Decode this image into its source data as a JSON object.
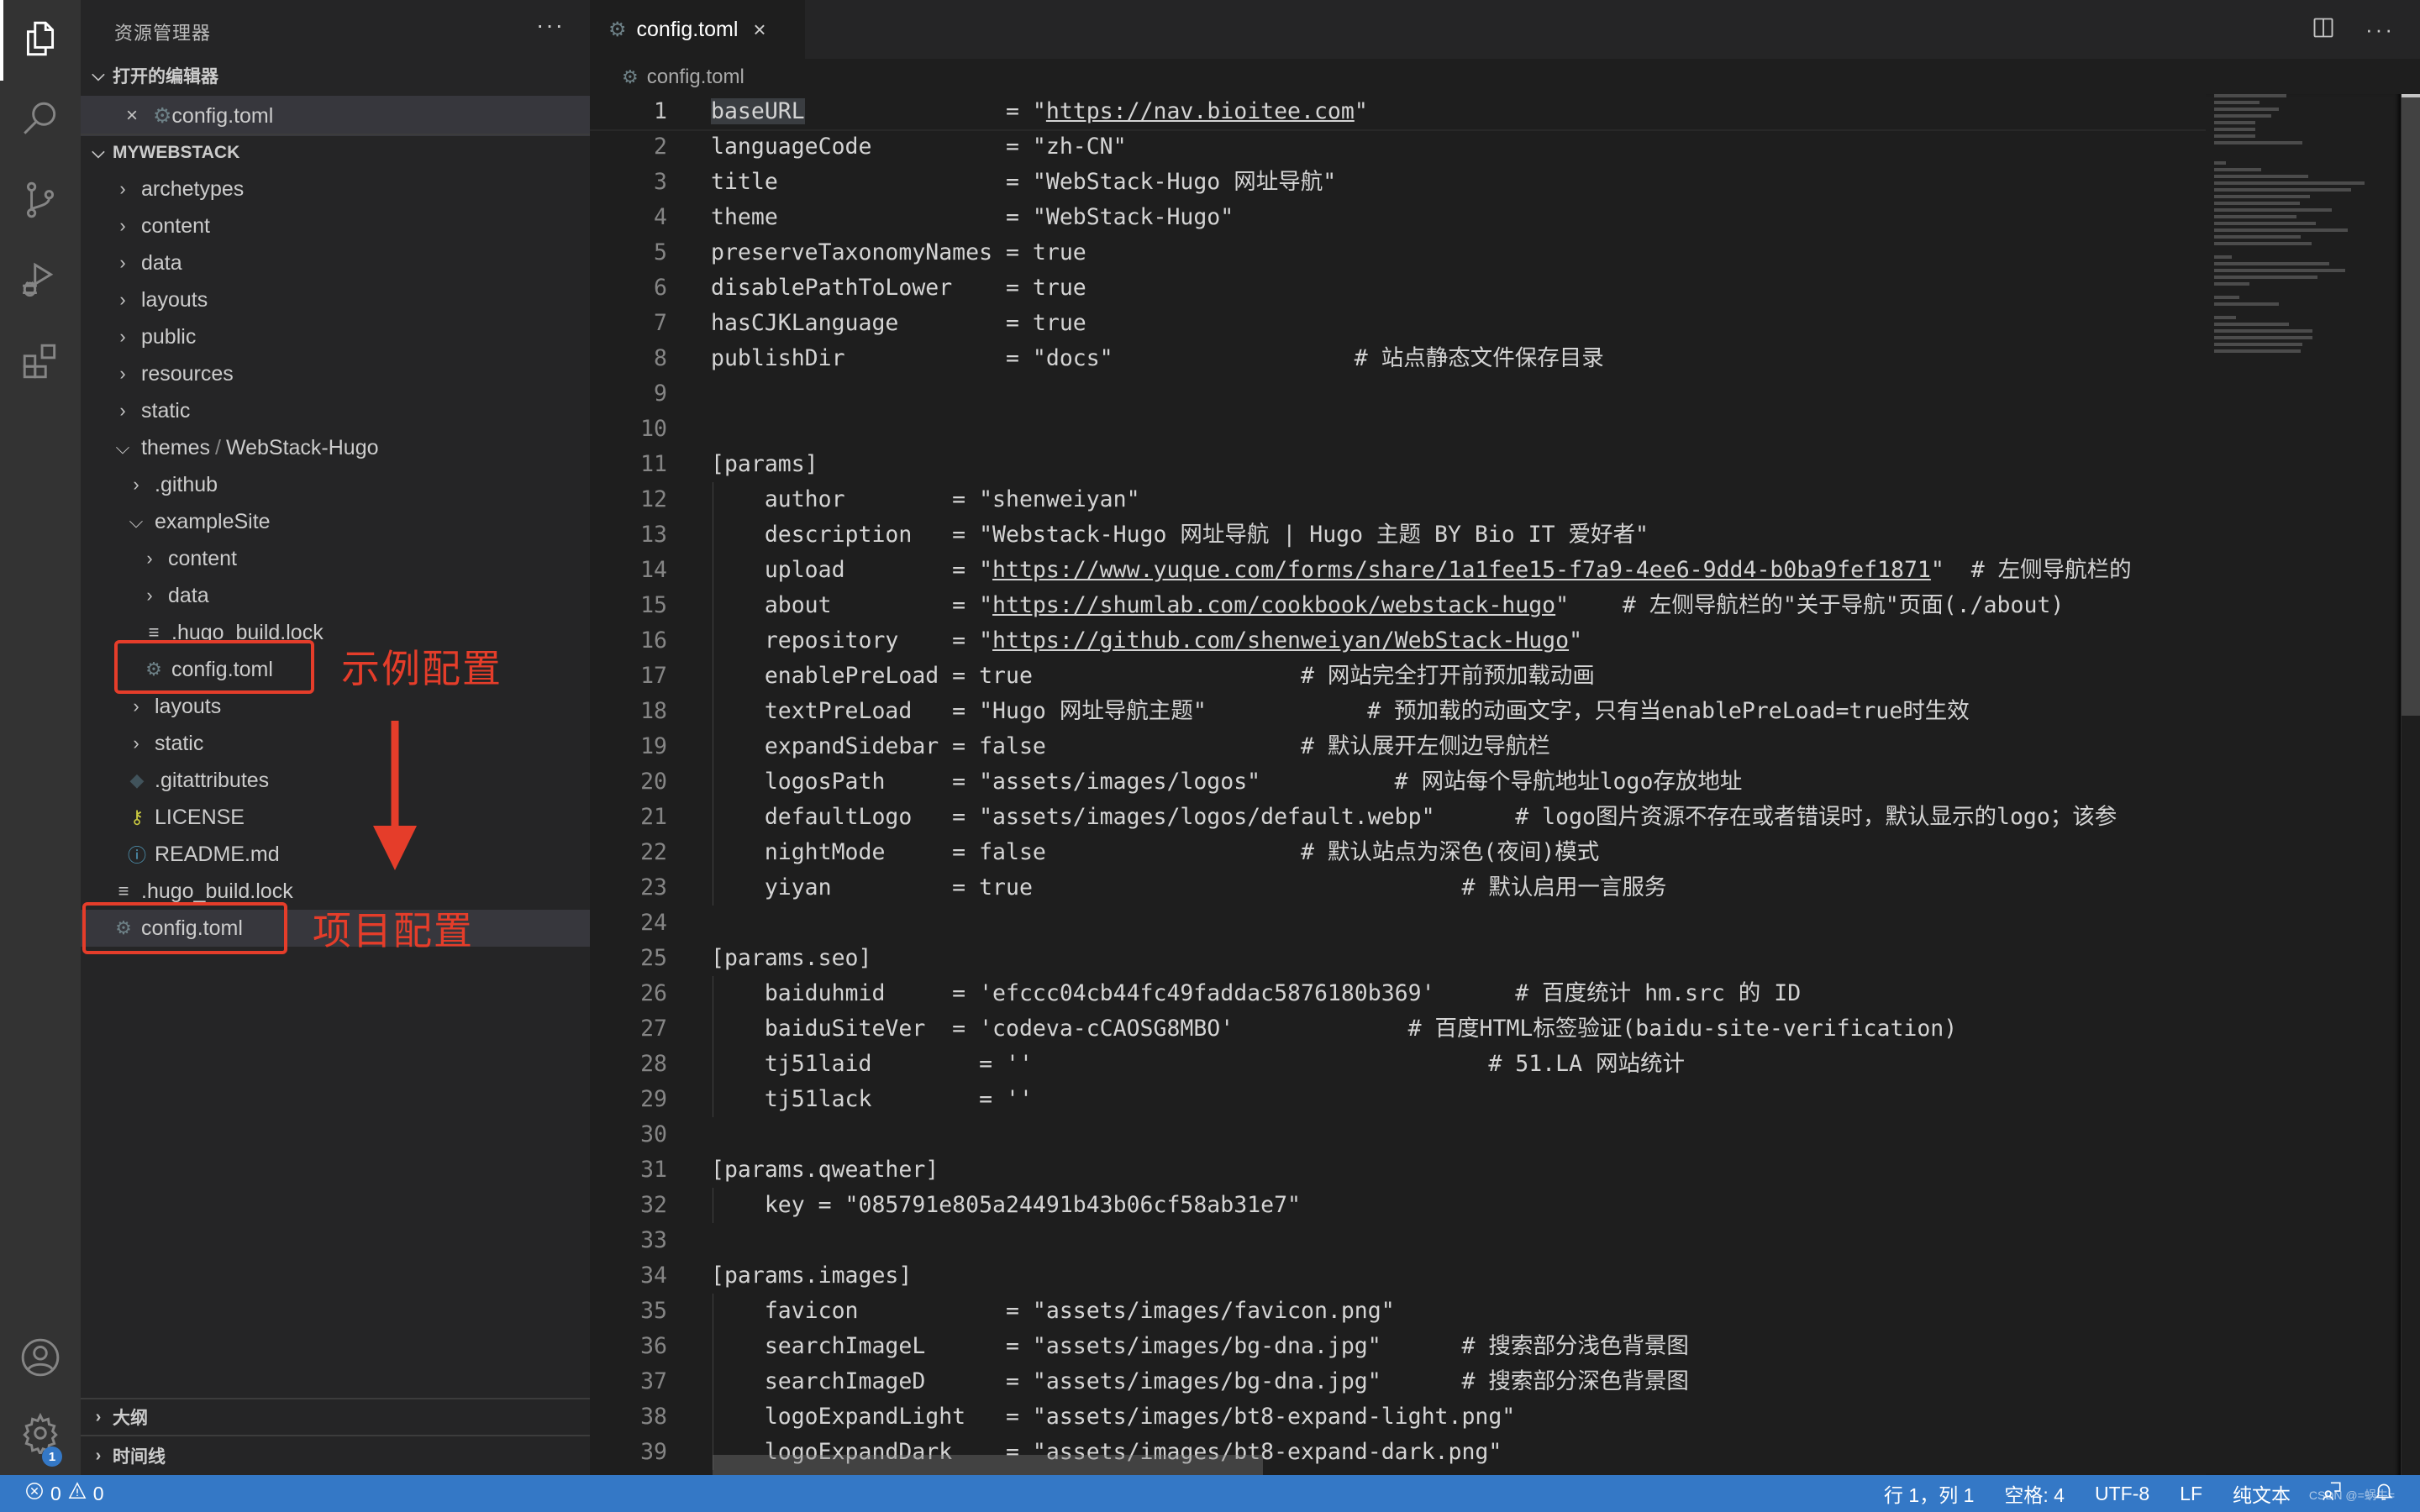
{
  "activity_bar": {
    "items": [
      {
        "name": "explorer",
        "icon": "files-icon",
        "active": true
      },
      {
        "name": "search",
        "icon": "search-icon"
      },
      {
        "name": "source-control",
        "icon": "source-control-icon"
      },
      {
        "name": "run-debug",
        "icon": "run-debug-icon"
      },
      {
        "name": "extensions",
        "icon": "extensions-icon"
      }
    ],
    "bottom": [
      {
        "name": "accounts",
        "icon": "account-icon"
      },
      {
        "name": "manage",
        "icon": "gear-icon",
        "badge": "1"
      }
    ]
  },
  "sidebar": {
    "title": "资源管理器",
    "more": "···",
    "open_editors": {
      "label": "打开的编辑器",
      "items": [
        {
          "label": "config.toml",
          "icon": "gear-icon"
        }
      ]
    },
    "workspace": {
      "label": "MYWEBSTACK",
      "tree": [
        {
          "label": "archetypes",
          "type": "folder",
          "expanded": false,
          "depth": 0
        },
        {
          "label": "content",
          "type": "folder",
          "expanded": false,
          "depth": 0
        },
        {
          "label": "data",
          "type": "folder",
          "expanded": false,
          "depth": 0
        },
        {
          "label": "layouts",
          "type": "folder",
          "expanded": false,
          "depth": 0
        },
        {
          "label": "public",
          "type": "folder",
          "expanded": false,
          "depth": 0
        },
        {
          "label": "resources",
          "type": "folder",
          "expanded": false,
          "depth": 0
        },
        {
          "label": "static",
          "type": "folder",
          "expanded": false,
          "depth": 0
        },
        {
          "label": "themes",
          "label2": "WebStack-Hugo",
          "separator": "/",
          "type": "folder",
          "expanded": true,
          "depth": 0
        },
        {
          "label": ".github",
          "type": "folder",
          "expanded": false,
          "depth": 1
        },
        {
          "label": "exampleSite",
          "type": "folder",
          "expanded": true,
          "depth": 1
        },
        {
          "label": "content",
          "type": "folder",
          "expanded": false,
          "depth": 2
        },
        {
          "label": "data",
          "type": "folder",
          "expanded": false,
          "depth": 2
        },
        {
          "label": ".hugo_build.lock",
          "type": "file",
          "icon": "lines-icon",
          "depth": 2
        },
        {
          "label": "config.toml",
          "type": "file",
          "icon": "gear-icon",
          "depth": 2
        },
        {
          "label": "layouts",
          "type": "folder",
          "expanded": false,
          "depth": 1
        },
        {
          "label": "static",
          "type": "folder",
          "expanded": false,
          "depth": 1
        },
        {
          "label": ".gitattributes",
          "type": "file",
          "icon": "git-icon",
          "depth": 1
        },
        {
          "label": "LICENSE",
          "type": "file",
          "icon": "key-icon",
          "depth": 1
        },
        {
          "label": "README.md",
          "type": "file",
          "icon": "info-icon",
          "depth": 1
        },
        {
          "label": ".hugo_build.lock",
          "type": "file",
          "icon": "lines-icon",
          "depth": 0
        },
        {
          "label": "config.toml",
          "type": "file",
          "icon": "gear-icon",
          "depth": 0,
          "selected": true
        }
      ]
    },
    "outline_label": "大纲",
    "timeline_label": "时间线"
  },
  "annotations": {
    "example_label": "示例配置",
    "project_label": "项目配置",
    "color": "#e53d2a"
  },
  "editor": {
    "tab": {
      "label": "config.toml",
      "close": "×"
    },
    "breadcrumb": "config.toml",
    "lines": [
      {
        "n": "1",
        "t": "baseURL               = \"https://nav.bioitee.com\""
      },
      {
        "n": "2",
        "t": "languageCode          = \"zh-CN\""
      },
      {
        "n": "3",
        "t": "title                 = \"WebStack-Hugo 网址导航\""
      },
      {
        "n": "4",
        "t": "theme                 = \"WebStack-Hugo\""
      },
      {
        "n": "5",
        "t": "preserveTaxonomyNames = true"
      },
      {
        "n": "6",
        "t": "disablePathToLower    = true"
      },
      {
        "n": "7",
        "t": "hasCJKLanguage        = true"
      },
      {
        "n": "8",
        "t": "publishDir            = \"docs\"                  # 站点静态文件保存目录"
      },
      {
        "n": "9",
        "t": ""
      },
      {
        "n": "10",
        "t": ""
      },
      {
        "n": "11",
        "t": "[params]"
      },
      {
        "n": "12",
        "t": "    author        = \"shenweiyan\""
      },
      {
        "n": "13",
        "t": "    description   = \"Webstack-Hugo 网址导航 | Hugo 主题 BY Bio IT 爱好者\""
      },
      {
        "n": "14",
        "t": "    upload        = \"https://www.yuque.com/forms/share/1a1fee15-f7a9-4ee6-9dd4-b0ba9fef1871\"  # 左侧导航栏的"
      },
      {
        "n": "15",
        "t": "    about         = \"https://shumlab.com/cookbook/webstack-hugo\"    # 左侧导航栏的\"关于导航\"页面(./about)"
      },
      {
        "n": "16",
        "t": "    repository    = \"https://github.com/shenweiyan/WebStack-Hugo\""
      },
      {
        "n": "17",
        "t": "    enablePreLoad = true                    # 网站完全打开前预加载动画"
      },
      {
        "n": "18",
        "t": "    textPreLoad   = \"Hugo 网址导航主题\"            # 预加载的动画文字，只有当enablePreLoad=true时生效"
      },
      {
        "n": "19",
        "t": "    expandSidebar = false                   # 默认展开左侧边导航栏"
      },
      {
        "n": "20",
        "t": "    logosPath     = \"assets/images/logos\"          # 网站每个导航地址logo存放地址"
      },
      {
        "n": "21",
        "t": "    defaultLogo   = \"assets/images/logos/default.webp\"      # logo图片资源不存在或者错误时，默认显示的logo；该参"
      },
      {
        "n": "22",
        "t": "    nightMode     = false                   # 默认站点为深色(夜间)模式"
      },
      {
        "n": "23",
        "t": "    yiyan         = true                                # 默认启用一言服务"
      },
      {
        "n": "24",
        "t": ""
      },
      {
        "n": "25",
        "t": "[params.seo]"
      },
      {
        "n": "26",
        "t": "    baiduhmid     = 'efccc04cb44fc49faddac5876180b369'      # 百度统计 hm.src 的 ID"
      },
      {
        "n": "27",
        "t": "    baiduSiteVer  = 'codeva-cCAOSG8MBO'             # 百度HTML标签验证(baidu-site-verification)"
      },
      {
        "n": "28",
        "t": "    tj51laid        = ''                                  # 51.LA 网站统计"
      },
      {
        "n": "29",
        "t": "    tj51lack        = ''"
      },
      {
        "n": "30",
        "t": ""
      },
      {
        "n": "31",
        "t": "[params.qweather]"
      },
      {
        "n": "32",
        "t": "    key = \"085791e805a24491b43b06cf58ab31e7\""
      },
      {
        "n": "33",
        "t": ""
      },
      {
        "n": "34",
        "t": "[params.images]"
      },
      {
        "n": "35",
        "t": "    favicon           = \"assets/images/favicon.png\""
      },
      {
        "n": "36",
        "t": "    searchImageL      = \"assets/images/bg-dna.jpg\"      # 搜索部分浅色背景图"
      },
      {
        "n": "37",
        "t": "    searchImageD      = \"assets/images/bg-dna.jpg\"      # 搜索部分深色背景图"
      },
      {
        "n": "38",
        "t": "    logoExpandLight   = \"assets/images/bt8-expand-light.png\""
      },
      {
        "n": "39",
        "t": "    logoExpandDark    = \"assets/images/bt8-expand-dark.png\""
      }
    ]
  },
  "statusbar": {
    "errors": "0",
    "warnings": "0",
    "position": "行 1，列 1",
    "spaces": "空格: 4",
    "encoding": "UTF-8",
    "eol": "LF",
    "language": "纯文本",
    "watermark": "CSDN @=蜗牛=",
    "color": "#3478c6"
  }
}
